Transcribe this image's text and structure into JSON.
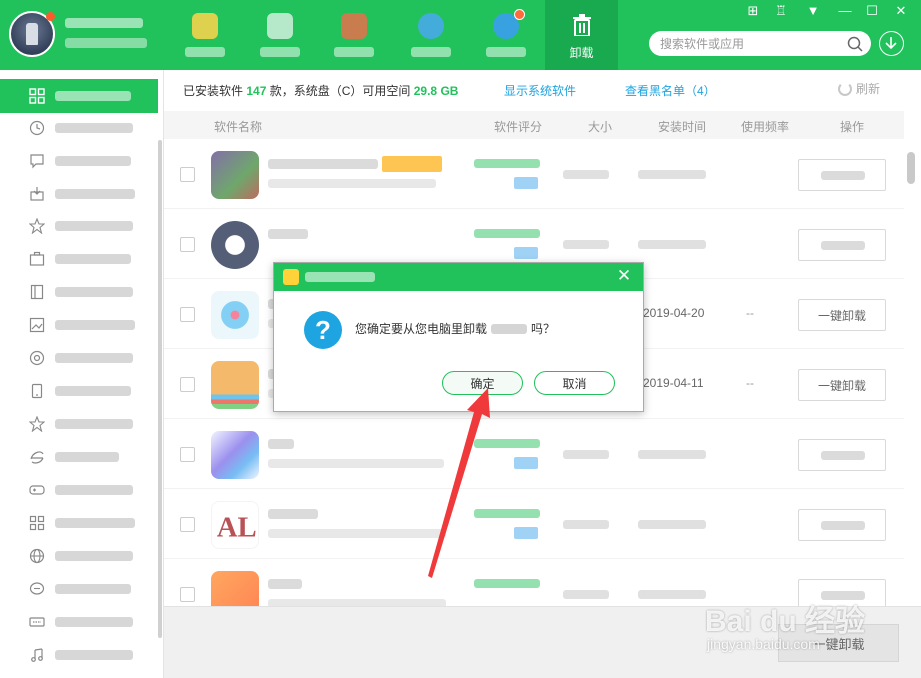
{
  "topbar": {
    "active_tab_label": "卸载",
    "search_placeholder": "搜索软件或应用",
    "window_controls": [
      "grid-icon",
      "shirt-icon",
      "menu-down-icon",
      "minimize-icon",
      "maximize-icon",
      "close-icon"
    ]
  },
  "info": {
    "prefix": "已安装软件",
    "count": "147",
    "mid": "款，系统盘（C）可用空间",
    "space": "29.8 GB",
    "show_system": "显示系统软件",
    "blacklist": "查看黑名单（4）",
    "refresh": "刷新"
  },
  "table": {
    "headers": [
      "软件名称",
      "软件评分",
      "大小",
      "安装时间",
      "使用频率",
      "操作"
    ],
    "rows": [
      {
        "date": "",
        "freq": "",
        "action": ""
      },
      {
        "date": "",
        "freq": "",
        "action": ""
      },
      {
        "date": "2019-04-20",
        "freq": "--",
        "action": "一键卸载"
      },
      {
        "date": "2019-04-11",
        "freq": "--",
        "action": "一键卸载"
      },
      {
        "date": "",
        "freq": "",
        "action": ""
      },
      {
        "date": "",
        "freq": "",
        "action": ""
      },
      {
        "date": "",
        "freq": "",
        "action": ""
      }
    ],
    "bulk_uninstall": "一键卸载"
  },
  "dialog": {
    "msg_before": "您确定要从您电脑里卸载",
    "msg_after": "吗？",
    "ok": "确定",
    "cancel": "取消",
    "close": "✕"
  },
  "watermark": {
    "main": "Bai du 经验",
    "sub": "jingyan.baidu.com"
  },
  "colors": {
    "brand_green": "#21c25c",
    "link_blue": "#1ea4e0",
    "arrow_red": "#f0393a"
  }
}
